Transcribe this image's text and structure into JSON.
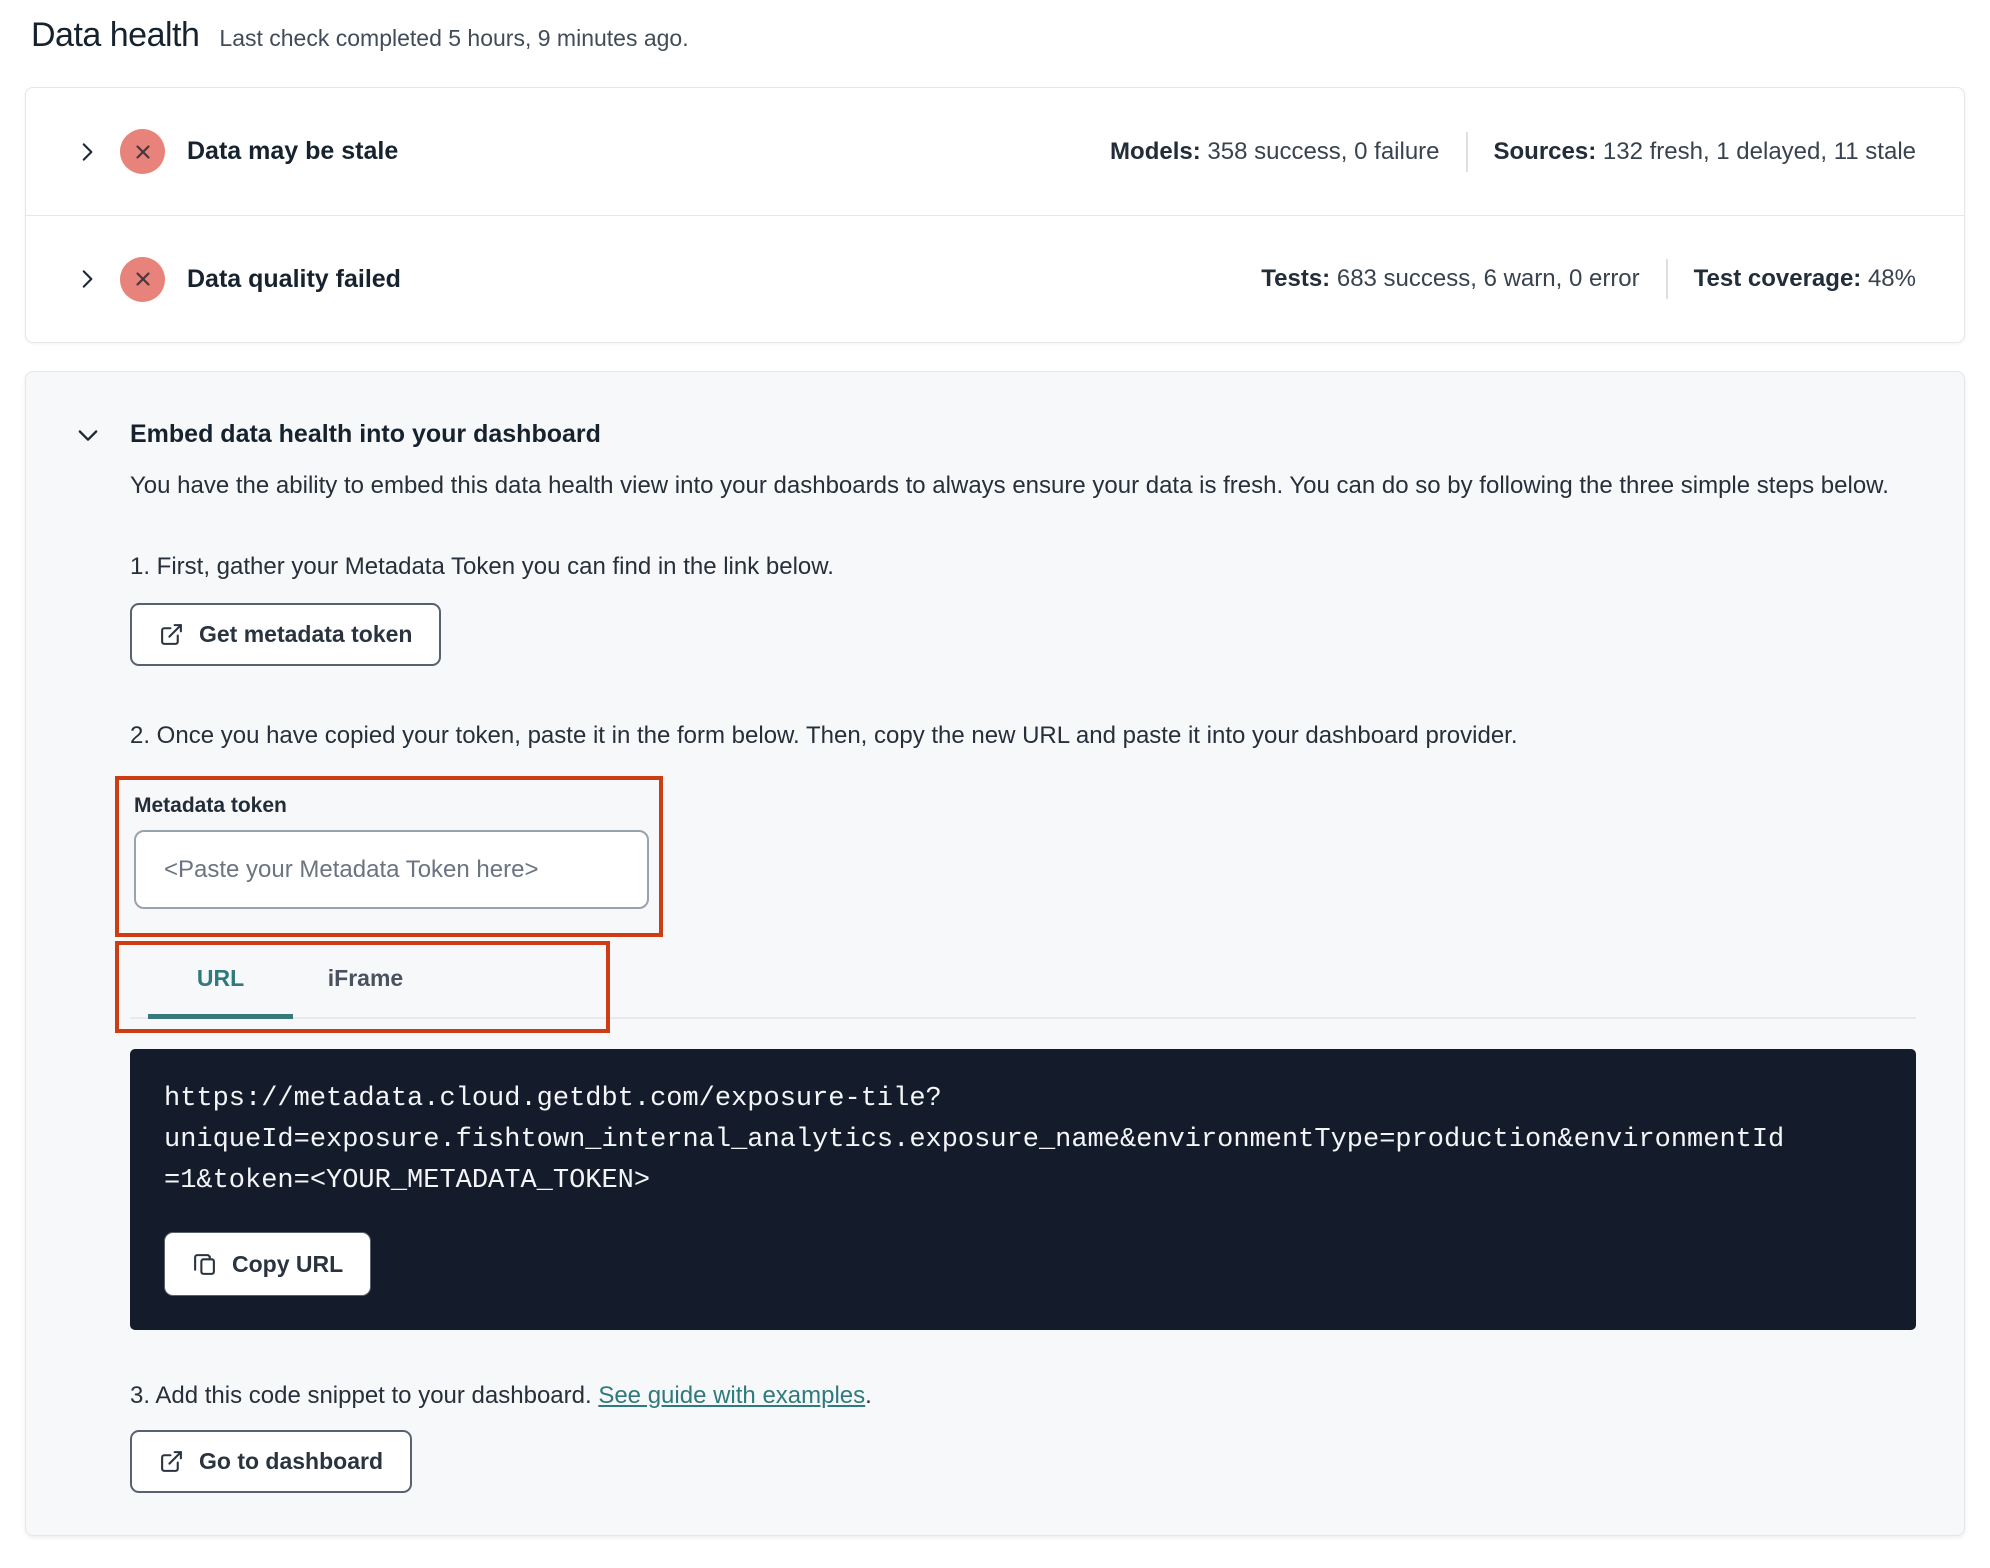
{
  "header": {
    "title": "Data health",
    "subtitle": "Last check completed 5 hours, 9 minutes ago."
  },
  "panels": [
    {
      "label": "Data may be stale",
      "status_icon": "error-x-circle",
      "stats": [
        {
          "label": "Models:",
          "value": "358 success, 0 failure"
        },
        {
          "label": "Sources:",
          "value": "132 fresh, 1 delayed, 11 stale"
        }
      ]
    },
    {
      "label": "Data quality failed",
      "status_icon": "error-x-circle",
      "stats": [
        {
          "label": "Tests:",
          "value": "683 success, 6 warn, 0 error"
        },
        {
          "label": "Test coverage:",
          "value": "48%"
        }
      ]
    }
  ],
  "embed": {
    "title": "Embed data health into your dashboard",
    "description": "You have the ability to embed this data health view into your dashboards to always ensure your data is fresh. You can do so by following the three simple steps below.",
    "step1_text": "1. First, gather your Metadata Token you can find in the link below.",
    "get_token_label": "Get metadata token",
    "step2_text": "2. Once you have copied your token, paste it in the form below. Then, copy the new URL and paste it into your dashboard provider.",
    "token_label": "Metadata token",
    "token_placeholder": "<Paste your Metadata Token here>",
    "tabs": [
      {
        "label": "URL",
        "active": true
      },
      {
        "label": "iFrame",
        "active": false
      }
    ],
    "code_lines": [
      "https://metadata.cloud.getdbt.com/exposure-tile?",
      "uniqueId=exposure.fishtown_internal_analytics.exposure_name&environmentType=production&environmentId",
      "=1&token=<YOUR_METADATA_TOKEN>"
    ],
    "copy_label": "Copy URL",
    "step3_prefix": "3. Add this code snippet to your dashboard. ",
    "step3_link": "See guide with examples",
    "step3_suffix": ".",
    "dashboard_label": "Go to dashboard"
  },
  "colors": {
    "error_badge_bg": "#e8837b",
    "error_badge_x": "#463740",
    "annotation_red": "#ce3c13",
    "accent_teal": "#2f7a7c",
    "code_block_bg": "#141c2b",
    "section_bg": "#f7f8f9"
  }
}
